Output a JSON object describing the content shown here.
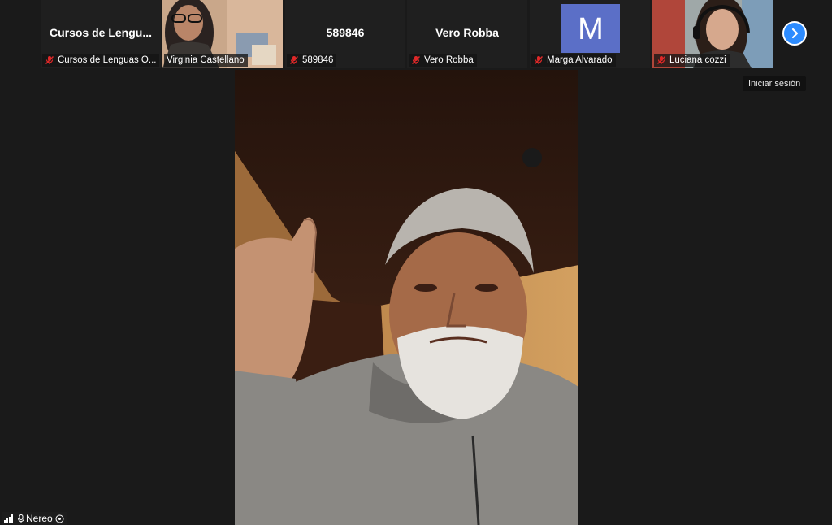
{
  "participants": [
    {
      "name": "Cursos de Lenguas Originarias",
      "display_title": "Cursos de Lengu...",
      "caption": "Cursos de Lenguas O...",
      "muted": true,
      "type": "name"
    },
    {
      "name": "Virginia Castellano",
      "caption": "Virginia Castellano",
      "muted": false,
      "type": "video"
    },
    {
      "name": "589846",
      "display_title": "589846",
      "caption": "589846",
      "muted": true,
      "type": "name"
    },
    {
      "name": "Vero Robba",
      "display_title": "Vero Robba",
      "caption": "Vero Robba",
      "muted": true,
      "type": "name"
    },
    {
      "name": "Marga Alvarado",
      "avatar_letter": "M",
      "caption": "Marga Alvarado",
      "muted": true,
      "type": "avatar"
    },
    {
      "name": "Luciana cozzi",
      "caption": "Luciana cozzi",
      "muted": true,
      "type": "video"
    }
  ],
  "next_page_button": {
    "icon": "chevron-right-icon"
  },
  "tooltip": "Iniciar sesión",
  "active_speaker": {
    "name": "Nereo"
  },
  "colors": {
    "background": "#1a1a1a",
    "accent": "#2d8cff",
    "muted_red": "#e02828",
    "avatar": "#5b6fc7"
  }
}
